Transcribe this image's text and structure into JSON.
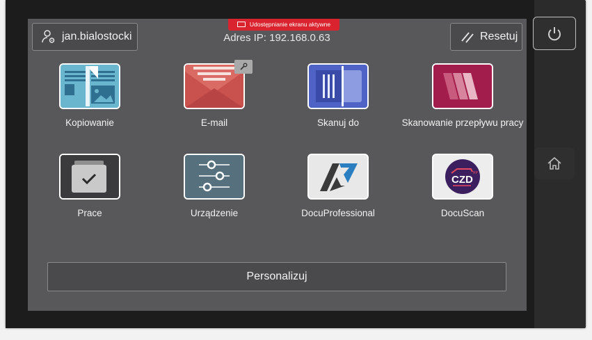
{
  "banner": {
    "text": "Udostępnianie ekranu aktywne"
  },
  "header": {
    "ip_text": "Adres IP: 192.168.0.63",
    "user_label": "jan.bialostocki",
    "reset_label": "Resetuj"
  },
  "apps": [
    {
      "label": "Kopiowanie",
      "icon": "copy-icon"
    },
    {
      "label": "E-mail",
      "icon": "email-icon"
    },
    {
      "label": "Skanuj do",
      "icon": "scan-icon"
    },
    {
      "label": "Skanowanie przepływu pracy",
      "icon": "workflow-scan-icon"
    },
    {
      "label": "Prace",
      "icon": "jobs-icon"
    },
    {
      "label": "Urządzenie",
      "icon": "device-settings-icon"
    },
    {
      "label": "DocuProfessional",
      "icon": "docuprofessional-logo"
    },
    {
      "label": "DocuScan",
      "icon": "docuscan-logo"
    }
  ],
  "personalize_label": "Personalizuj",
  "colors": {
    "screen_bg": "#58585a",
    "banner_red": "#d9232e",
    "copy_blue": "#6bb6cf",
    "email_red": "#c9514e",
    "scan_blue": "#4f62c6",
    "workflow_magenta": "#a21d4b"
  }
}
